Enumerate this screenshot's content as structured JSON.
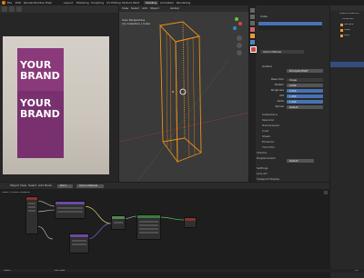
{
  "top_menu": {
    "items": [
      "File",
      "Edit",
      "Render",
      "Window",
      "Help",
      "Layout",
      "Modeling",
      "Sculpting",
      "UV Editing",
      "Texture Paint",
      "Shading",
      "Animation",
      "Rendering"
    ]
  },
  "image_editor": {
    "brand_lines": [
      "YOUR",
      "BRAND",
      "YOUR",
      "BRAND"
    ]
  },
  "viewport": {
    "header": "User Perspective",
    "subheader": "(1) Collection | Cube",
    "menu": [
      "View",
      "Select",
      "Add",
      "Object"
    ],
    "tool": "Global"
  },
  "outliner": {
    "title": "Scene Collection",
    "items": [
      "Collection",
      "Camera",
      "Cube",
      "Light"
    ]
  },
  "properties": {
    "object_name": "Cube",
    "material_slot": "Carton Material",
    "surface_label": "Surface",
    "surface_value": "Principled BSDF",
    "fields": [
      {
        "label": "Base Color",
        "value": "Image"
      },
      {
        "label": "Metallic",
        "value": "0.000"
      },
      {
        "label": "Roughness",
        "value": "0.500"
      },
      {
        "label": "IOR",
        "value": "1.450"
      },
      {
        "label": "Alpha",
        "value": "1.000"
      },
      {
        "label": "Normal",
        "value": "Default"
      }
    ],
    "sections": [
      "Subsurface",
      "Specular",
      "Transmission",
      "Coat",
      "Sheen",
      "Emission",
      "Thin Film",
      "Volume",
      "Displacement",
      "Settings",
      "Line Art",
      "Viewport Display",
      "Custom Properties"
    ],
    "displacement_value": "Default"
  },
  "node_editor": {
    "header": [
      "Object",
      "View",
      "Select",
      "Add",
      "Node"
    ],
    "slot": "Slot 1",
    "material": "Carton Material",
    "breadcrumb": "Cube > Carton Material"
  },
  "status_bar": {
    "left": "Select",
    "middle": "Pan View",
    "right": "4.2"
  }
}
